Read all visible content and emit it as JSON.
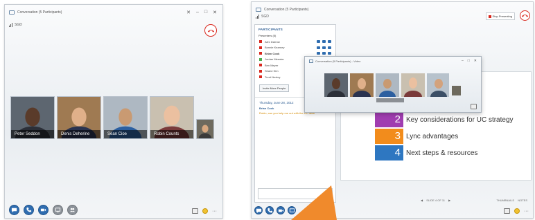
{
  "left_window": {
    "title": "Conversation (5 Participants)",
    "signal_label": "SGD",
    "controls": [
      "✕",
      "–",
      "□",
      "✕"
    ],
    "participants": [
      {
        "name": "Peter Seddon",
        "bg": "#5d6670",
        "skin": "#5a3b2a",
        "shirt": "#2b2f38"
      },
      {
        "name": "Denis Deherine",
        "bg": "#9f7a52",
        "skin": "#e0b08a",
        "shirt": "#2a3350"
      },
      {
        "name": "Sean Cioe",
        "bg": "#aeb8c2",
        "skin": "#c99a72",
        "shirt": "#2c5fa0"
      },
      {
        "name": "Robin Counts",
        "bg": "#c9c0b0",
        "skin": "#ebc0a0",
        "shirt": "#7a3a3a"
      }
    ],
    "self_thumb": {
      "bg": "#6e6a5e",
      "skin": "#d8a880",
      "shirt": "#3a3a3a"
    },
    "bottom_buttons": [
      "chat-bubble-icon",
      "phone-icon",
      "video-icon",
      "screen-share-icon",
      "participants-icon"
    ],
    "tray_icons": [
      "devices-icon",
      "smiley-icon",
      "more-icon"
    ],
    "more_label": "···"
  },
  "right_window": {
    "title": "Conversation (5 Participants)",
    "signal_label": "SGD",
    "stop_presenting_label": "Stop Presenting",
    "participants_panel": {
      "header": "PARTICIPANTS",
      "presenters_label": "Presenters (5)",
      "people": [
        {
          "name": "Alex Darrow",
          "status": "#d9281e"
        },
        {
          "name": "Bonnie Kearney",
          "status": "#d9281e"
        },
        {
          "name": "Brian Cook",
          "status": "#d9281e"
        },
        {
          "name": "Jordan Meester",
          "status": "#4caf50"
        },
        {
          "name": "Ben Meyer",
          "status": "#d9281e"
        },
        {
          "name": "Shane Kim",
          "status": "#d9281e"
        },
        {
          "name": "Trent Nexley",
          "status": "#d9281e"
        }
      ],
      "invite_label": "Invite More People"
    },
    "chat": {
      "date": "Thursday, June 28, 2012",
      "sender": "Brian Cook",
      "message": "Robin, can you help me out with the UC deck"
    },
    "video_popup": {
      "title": "Conversation (5 Participants) - Video",
      "controls": [
        "–",
        "□",
        "✕"
      ]
    },
    "slide_items": [
      {
        "num": "2",
        "text": "Key considerations for UC strategy",
        "color": "#a03db0"
      },
      {
        "num": "3",
        "text": "Lync advantages",
        "color": "#f28c1c"
      },
      {
        "num": "4",
        "text": "Next steps & resources",
        "color": "#2e77c1"
      }
    ],
    "pager_label": "SLIDE 4 OF 11",
    "thumbnails_label": "THUMBNAILS",
    "notes_label": "NOTES"
  },
  "colors": {
    "accent": "#2f6db0",
    "hangup": "#d9281e",
    "arrow": "#f08a2c"
  }
}
